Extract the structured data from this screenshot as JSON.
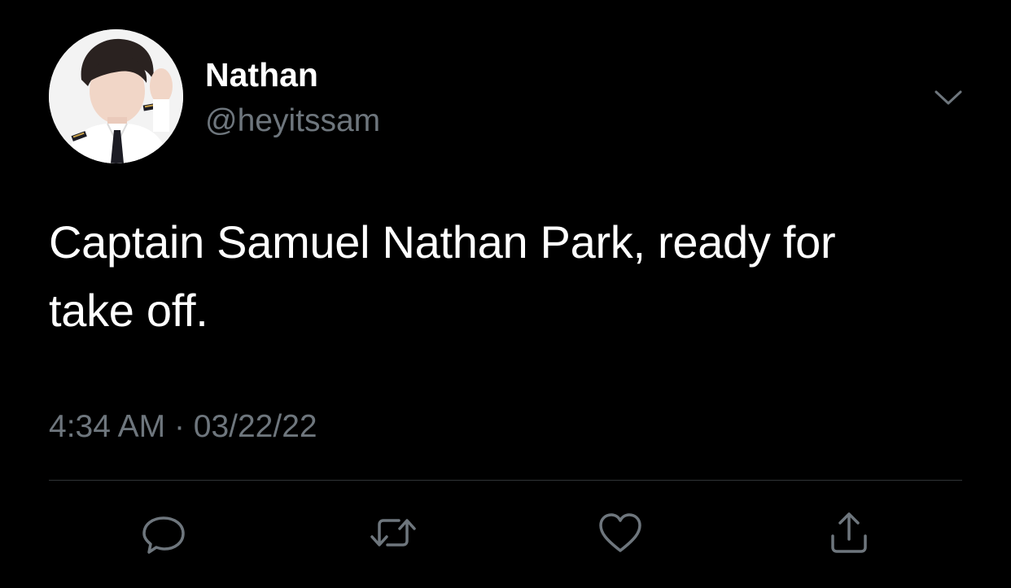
{
  "tweet": {
    "author": {
      "display_name": "Nathan",
      "handle": "@heyitssam"
    },
    "text_line1": "Captain Samuel Nathan Park, ready for",
    "text_line2": "take off.",
    "time": "4:34 AM",
    "separator": "·",
    "date": "03/22/22"
  },
  "icons": {
    "more": "chevron-down-icon",
    "reply": "reply-icon",
    "retweet": "retweet-icon",
    "like": "heart-icon",
    "share": "share-icon"
  },
  "colors": {
    "background": "#000000",
    "text_primary": "#ffffff",
    "text_secondary": "#6e767d",
    "divider": "#2f3336"
  }
}
